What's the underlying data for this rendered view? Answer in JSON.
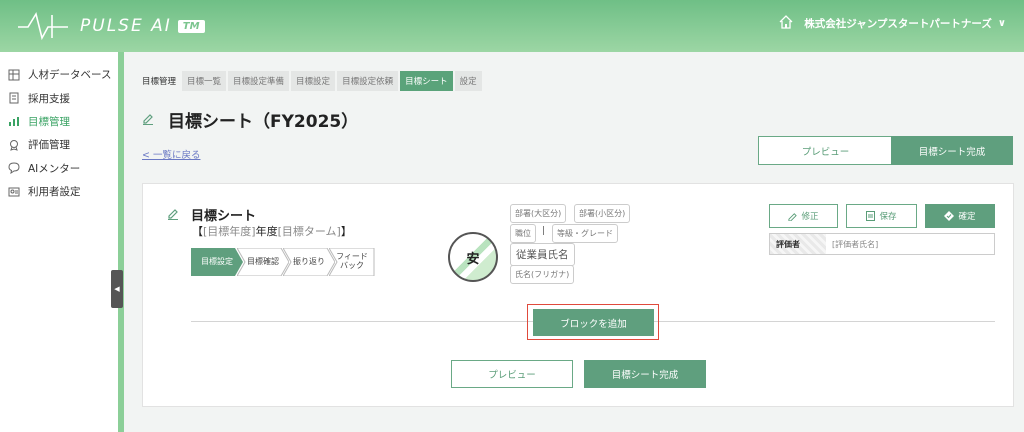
{
  "header": {
    "brand": "PULSE AI",
    "tm": "TM",
    "company": "株式会社ジャンプスタートパートナーズ",
    "chevron": "∨"
  },
  "sidebar": {
    "items": [
      {
        "label": "人材データベース",
        "icon": "grid-icon"
      },
      {
        "label": "採用支援",
        "icon": "document-icon"
      },
      {
        "label": "目標管理",
        "icon": "chart-icon",
        "active": true
      },
      {
        "label": "評価管理",
        "icon": "award-icon"
      },
      {
        "label": "AIメンター",
        "icon": "chat-icon"
      },
      {
        "label": "利用者設定",
        "icon": "user-settings-icon"
      }
    ]
  },
  "breadcrumb": {
    "root": "目標管理",
    "tabs": [
      "目標一覧",
      "目標設定準備",
      "目標設定",
      "目標設定依頼",
      "目標シート",
      "設定"
    ],
    "active_index": 4
  },
  "page": {
    "title": "目標シート（FY2025）",
    "back_link": "< 一覧に戻る",
    "preview_label": "プレビュー",
    "complete_label": "目標シート完成"
  },
  "card": {
    "title": "目標シート",
    "sub_open": "【",
    "sub_year": "[目標年度]",
    "sub_mid": "年度",
    "sub_term": "[目標ターム]",
    "sub_close": "】",
    "steps": [
      "目標設定",
      "目標確認",
      "振り返り",
      "フィード\nバック"
    ],
    "active_step": 0,
    "avatar_char": "安",
    "tags": {
      "dept_large": "部署(大区分)",
      "dept_small": "部署(小区分)",
      "position": "職位",
      "sep": "|",
      "grade": "等級・グレード",
      "employee_name": "従業員氏名",
      "furigana": "氏名(フリガナ)"
    },
    "edit_label": "修正",
    "save_label": "保存",
    "confirm_label": "確定",
    "evaluator_label": "評価者",
    "evaluator_value": "[評価者氏名]",
    "add_block_label": "ブロックを追加",
    "preview_label": "プレビュー",
    "complete_label": "目標シート完成"
  },
  "colors": {
    "accent": "#5f9f7e",
    "header": "#7cc58f",
    "highlight": "#e04a3c",
    "link": "#6a78c4"
  }
}
